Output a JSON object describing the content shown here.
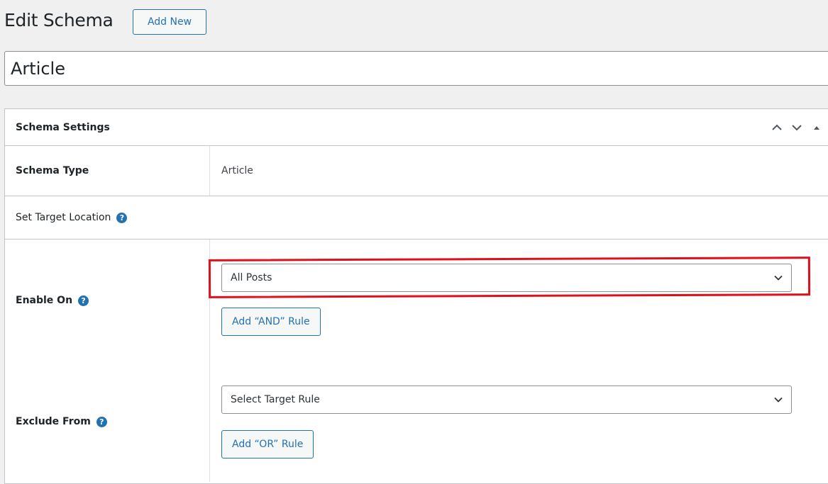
{
  "header": {
    "title": "Edit Schema",
    "add_new_label": "Add New"
  },
  "post_title": {
    "value": "Article"
  },
  "metabox": {
    "title": "Schema Settings",
    "schema_type_label": "Schema Type",
    "schema_type_value": "Article",
    "target_location_label": "Set Target Location",
    "enable_on_label": "Enable On",
    "enable_on_selected": "All Posts",
    "add_and_rule_label": "Add “AND” Rule",
    "exclude_from_label": "Exclude From",
    "exclude_from_selected": "Select Target Rule",
    "add_or_rule_label": "Add “OR” Rule",
    "help_glyph": "?"
  },
  "colors": {
    "accent": "#2271b1",
    "highlight": "#e0101a",
    "background": "#f0f0f1"
  },
  "icons": {
    "move_up": "chevron-up-icon",
    "move_down": "chevron-down-icon",
    "toggle": "triangle-up-icon",
    "select_arrow": "chevron-down-icon",
    "help": "help-icon"
  }
}
